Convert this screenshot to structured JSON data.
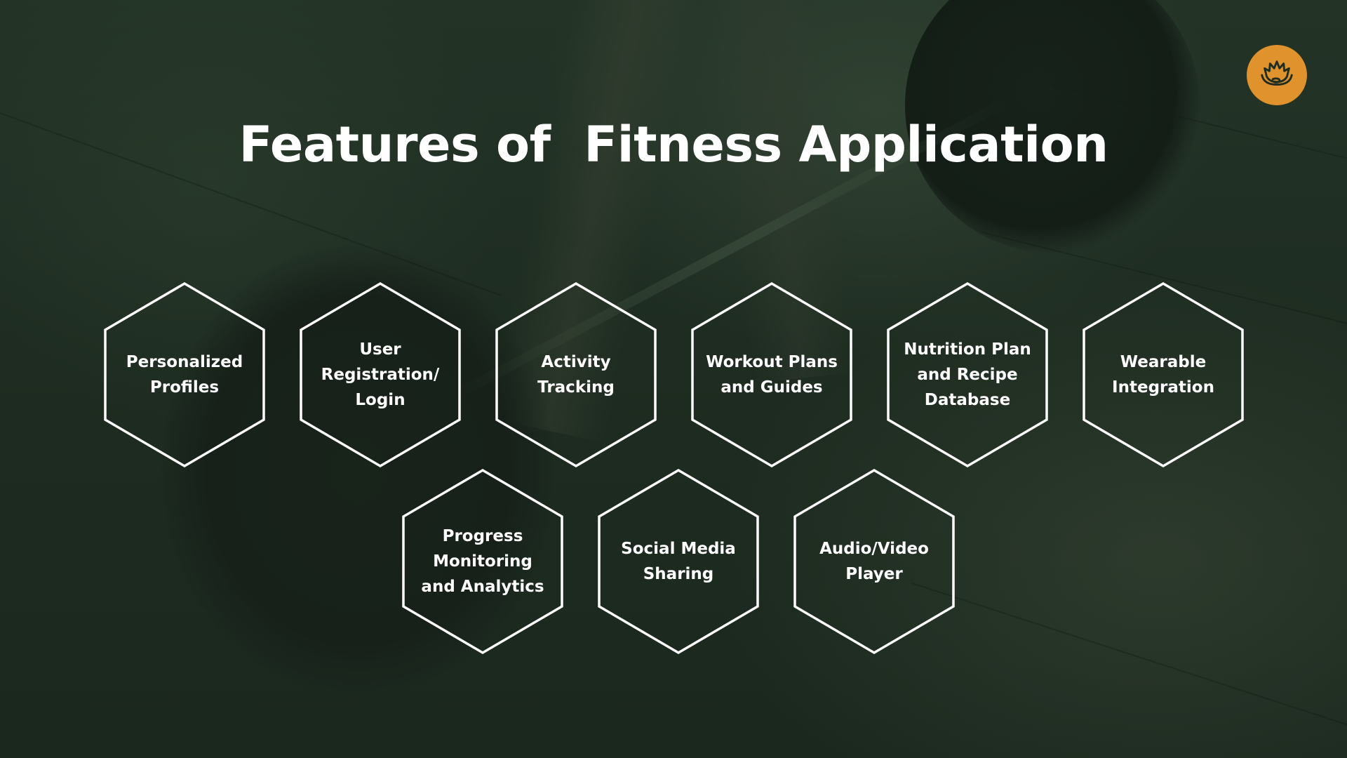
{
  "slide": {
    "title": "Features of  Fitness Application",
    "logo": {
      "icon": "lotus-icon",
      "background_color": "#e0922c",
      "icon_color": "#1f2d21"
    },
    "colors": {
      "background": "#1e2c21",
      "text": "#ffffff",
      "hexagon_stroke": "#ffffff"
    },
    "features": [
      {
        "label": "Personalized\nProfiles"
      },
      {
        "label": "User\nRegistration/\nLogin"
      },
      {
        "label": "Activity\nTracking"
      },
      {
        "label": "Workout Plans\nand Guides"
      },
      {
        "label": "Nutrition Plan\nand Recipe\nDatabase"
      },
      {
        "label": "Wearable\nIntegration"
      },
      {
        "label": "Progress\nMonitoring\nand Analytics"
      },
      {
        "label": "Social Media\nSharing"
      },
      {
        "label": "Audio/Video\nPlayer"
      }
    ]
  }
}
